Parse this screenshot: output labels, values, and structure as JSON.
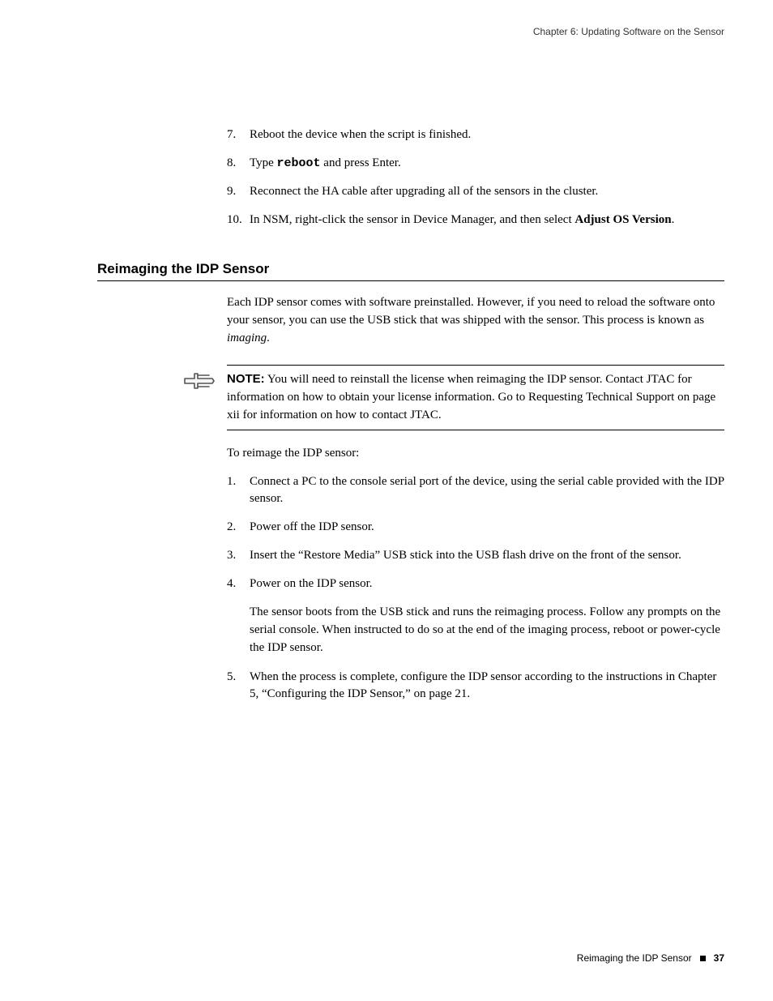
{
  "header": {
    "chapter_line": "Chapter 6: Updating Software on the Sensor"
  },
  "upgrade_steps": {
    "s7": {
      "num": "7.",
      "text": "Reboot the device when the script is finished."
    },
    "s8": {
      "num": "8.",
      "pre": "Type ",
      "code": "reboot",
      "post": " and press Enter."
    },
    "s9": {
      "num": "9.",
      "text": "Reconnect the HA cable after upgrading all of the sensors in the cluster."
    },
    "s10": {
      "num": "10.",
      "pre": "In NSM, right-click the sensor in Device Manager, and then select ",
      "bold": "Adjust OS Version",
      "post": "."
    }
  },
  "section": {
    "title": "Reimaging the IDP Sensor",
    "intro_pre": "Each IDP sensor comes with software preinstalled. However, if you need to reload the software onto your sensor, you can use the USB stick that was shipped with the sensor. This process is known as ",
    "intro_italic": "imaging",
    "intro_post": "."
  },
  "note": {
    "label": "NOTE:",
    "text": " You will need to reinstall the license when reimaging the IDP sensor. Contact JTAC for information on how to obtain your license information. Go to Requesting Technical Support on page xii for information on how to contact JTAC."
  },
  "reimage": {
    "lead": "To reimage the IDP sensor:",
    "s1": {
      "num": "1.",
      "text": "Connect a PC to the console serial port of the device, using the serial cable provided with the IDP sensor."
    },
    "s2": {
      "num": "2.",
      "text": "Power off the IDP sensor."
    },
    "s3": {
      "num": "3.",
      "text": "Insert the “Restore Media” USB stick into the USB flash drive on the front of the sensor."
    },
    "s4": {
      "num": "4.",
      "text": "Power on the IDP sensor.",
      "sub": "The sensor boots from the USB stick and runs the reimaging process. Follow any prompts on the serial console. When instructed to do so at the end of the imaging process, reboot or power-cycle the IDP sensor."
    },
    "s5": {
      "num": "5.",
      "text": "When the process is complete, configure the IDP sensor according to the instructions in Chapter 5, “Configuring the IDP Sensor,” on page 21."
    }
  },
  "footer": {
    "title": "Reimaging the IDP Sensor",
    "page": "37"
  }
}
